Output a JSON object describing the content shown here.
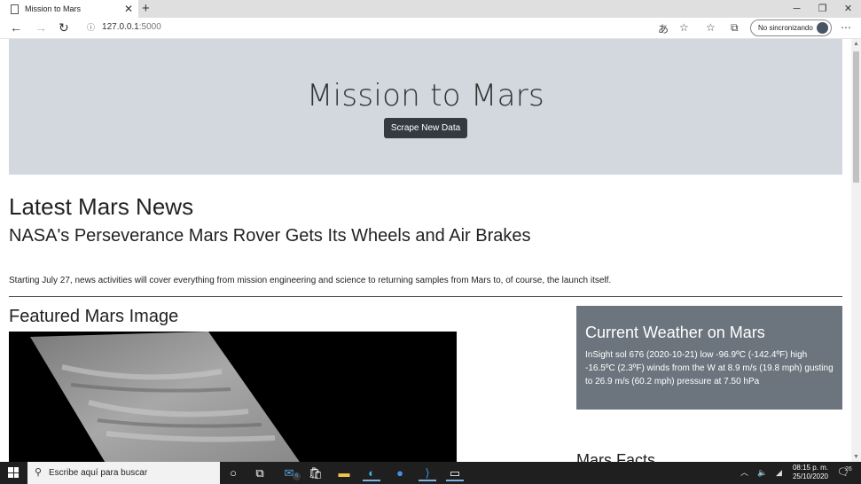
{
  "browser": {
    "tab_title": "Mission to Mars",
    "address_host": "127.0.0.1",
    "address_port": ":5000",
    "profile_label": "No sincronizando"
  },
  "jumbotron": {
    "title": "Mission to Mars",
    "button_label": "Scrape New Data",
    "background": "#d2d8de"
  },
  "news": {
    "heading": "Latest Mars News",
    "title": "NASA's Perseverance Mars Rover Gets Its Wheels and Air Brakes",
    "paragraph": "Starting July 27, news activities will cover everything from mission engineering and science to returning samples from Mars to, of course, the launch itself."
  },
  "featured": {
    "heading": "Featured Mars Image"
  },
  "weather": {
    "heading": "Current Weather on Mars",
    "text": "InSight sol 676 (2020-10-21) low -96.9ºC (-142.4ºF) high -16.5ºC (2.3ºF) winds from the W at 8.9 m/s (19.8 mph) gusting to 26.9 m/s (60.2 mph) pressure at 7.50 hPa",
    "background": "#6c757d"
  },
  "facts": {
    "heading": "Mars Facts"
  },
  "taskbar": {
    "search_placeholder": "Escribe aquí para buscar",
    "mail_badge": "6",
    "time": "08:15 p. m.",
    "date": "25/10/2020",
    "notification_count": "26"
  }
}
